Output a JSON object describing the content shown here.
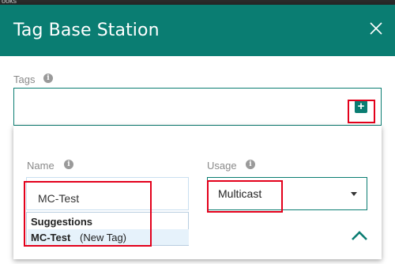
{
  "background": {
    "top_text": "ooks"
  },
  "dialog": {
    "title": "Tag Base Station",
    "close_icon": "close-icon"
  },
  "tags": {
    "label": "Tags",
    "add_icon": "plus-icon"
  },
  "name_field": {
    "label": "Name",
    "value": "MC-Test"
  },
  "usage_field": {
    "label": "Usage",
    "value": "Multicast"
  },
  "suggestions": {
    "header": "Suggestions",
    "items": [
      {
        "name": "MC-Test",
        "note": "(New Tag)"
      }
    ]
  },
  "colors": {
    "accent": "#0a7d72",
    "highlight": "#e3001b",
    "suggestion_bg": "#e6f2fb"
  }
}
